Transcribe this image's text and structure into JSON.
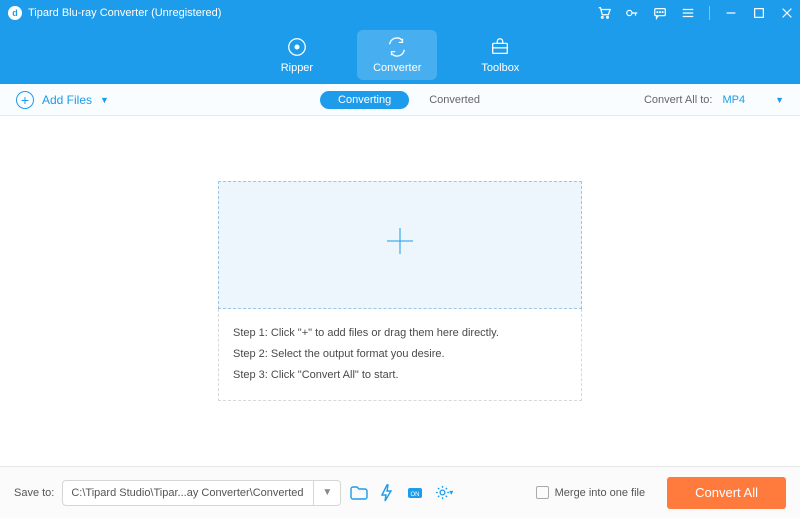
{
  "title": "Tipard Blu-ray Converter (Unregistered)",
  "nav": {
    "ripper": "Ripper",
    "converter": "Converter",
    "toolbox": "Toolbox"
  },
  "addFiles": "Add Files",
  "subtabs": {
    "converting": "Converting",
    "converted": "Converted"
  },
  "convertAll": {
    "label": "Convert All to:",
    "format": "MP4"
  },
  "steps": {
    "s1": "Step 1: Click \"+\" to add files or drag them here directly.",
    "s2": "Step 2: Select the output format you desire.",
    "s3": "Step 3: Click \"Convert All\" to start."
  },
  "footer": {
    "saveLabel": "Save to:",
    "path": "C:\\Tipard Studio\\Tipar...ay Converter\\Converted",
    "mergeLabel": "Merge into one file",
    "convertBtn": "Convert All"
  }
}
